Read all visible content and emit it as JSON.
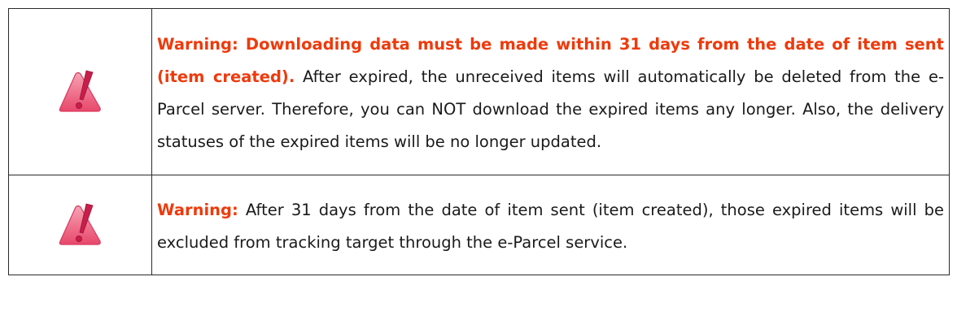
{
  "notes": [
    {
      "icon": "warning-icon",
      "lead": "Warning: Downloading data must be made within 31 days from the date of item sent (item created).",
      "body": " After expired, the unreceived items will automatically be deleted from the e-Parcel server. Therefore, you can NOT download the expired items any longer. Also, the delivery statuses of the expired items will be no longer updated."
    },
    {
      "icon": "warning-icon",
      "lead": "Warning:",
      "body": " After 31 days from the date of item sent (item created), those expired items will be excluded from tracking target through the e-Parcel service."
    }
  ],
  "colors": {
    "lead_text": "#ee3a0c",
    "icon_fill": "#e8476a",
    "icon_mark": "#c81e4a"
  }
}
